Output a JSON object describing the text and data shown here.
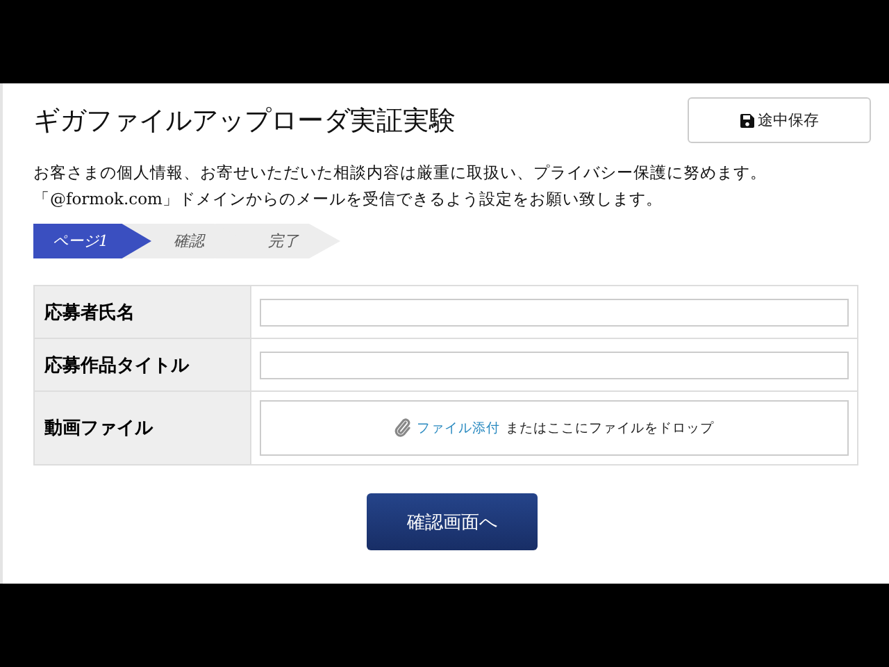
{
  "header": {
    "title": "ギガファイルアップローダ実証実験",
    "save_button": "途中保存"
  },
  "notice": [
    "お客さまの個人情報、お寄せいただいた相談内容は厳重に取扱い、プライバシー保護に努めます。",
    "「@formok.com」ドメインからのメールを受信できるよう設定をお願い致します。"
  ],
  "steps": [
    {
      "label": "ページ1",
      "selected": true
    },
    {
      "label": "確認",
      "selected": false
    },
    {
      "label": "完了",
      "selected": false
    }
  ],
  "form": {
    "rows": [
      {
        "kind": "text",
        "label": "応募者氏名"
      },
      {
        "kind": "text",
        "label": "応募作品タイトル"
      },
      {
        "kind": "file",
        "label": "動画ファイル",
        "link": "ファイル添付",
        "hint": "またはここにファイルをドロップ"
      }
    ]
  },
  "submit_button": "確認画面へ"
}
